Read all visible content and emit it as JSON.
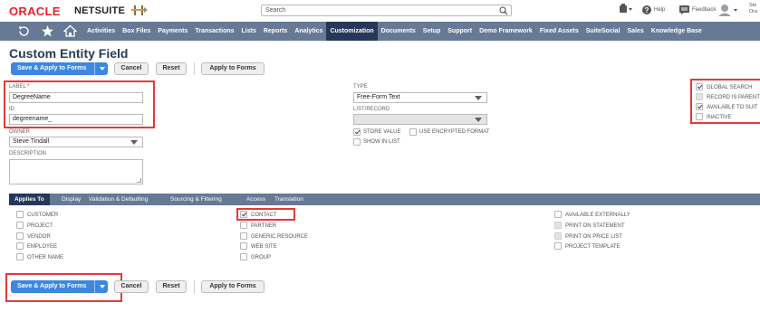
{
  "header": {
    "brand_oracle": "ORACLE",
    "brand_netsuite": "NETSUITE",
    "search_placeholder": "Search",
    "help": "Help",
    "feedback": "Feedback",
    "user_name": "Ste",
    "user_org": "Ora"
  },
  "nav": {
    "items": [
      "Activities",
      "Box Files",
      "Payments",
      "Transactions",
      "Lists",
      "Reports",
      "Analytics",
      "Customization",
      "Documents",
      "Setup",
      "Support",
      "Demo Framework",
      "Fixed Assets",
      "SuiteSocial",
      "Sales",
      "Knowledge Base"
    ],
    "active": "Customization"
  },
  "page": {
    "title": "Custom Entity Field"
  },
  "toolbar": {
    "save_apply": "Save & Apply to Forms",
    "cancel": "Cancel",
    "reset": "Reset",
    "apply_forms": "Apply to Forms"
  },
  "form": {
    "label_label": "LABEL",
    "label_value": "DegreeName",
    "id_label": "ID",
    "id_value": "degreename_",
    "owner_label": "OWNER",
    "owner_value": "Steve Tindall",
    "description_label": "DESCRIPTION",
    "type_label": "TYPE",
    "type_value": "Free-Form Text",
    "list_record_label": "LIST/RECORD",
    "store_value": "STORE VALUE",
    "use_encrypted": "USE ENCRYPTED FORMAT",
    "show_in_list": "SHOW IN LIST",
    "global_search": "GLOBAL SEARCH",
    "record_is_parent": "RECORD IS PARENT",
    "available_to_suitetalk": "AVAILABLE TO SUIT",
    "inactive": "INACTIVE"
  },
  "subtabs": {
    "applies_to": "Applies To",
    "display": "Display",
    "validation": "Validation & Defaulting",
    "sourcing": "Sourcing & Filtering",
    "access": "Access",
    "translation": "Translation"
  },
  "applies": {
    "col1": [
      "CUSTOMER",
      "PROJECT",
      "VENDOR",
      "EMPLOYEE",
      "OTHER NAME"
    ],
    "col2": [
      "CONTACT",
      "PARTNER",
      "GENERIC RESOURCE",
      "WEB SITE",
      "GROUP"
    ],
    "col3": [
      "AVAILABLE EXTERNALLY",
      "PRINT ON STATEMENT",
      "PRINT ON PRICE LIST",
      "PROJECT TEMPLATE"
    ]
  },
  "colors": {
    "navbar": "#667a95",
    "nav_active": "#26385a",
    "primary_button": "#3d87e0",
    "highlight_box": "#e53935",
    "oracle_red": "#e8232a"
  }
}
